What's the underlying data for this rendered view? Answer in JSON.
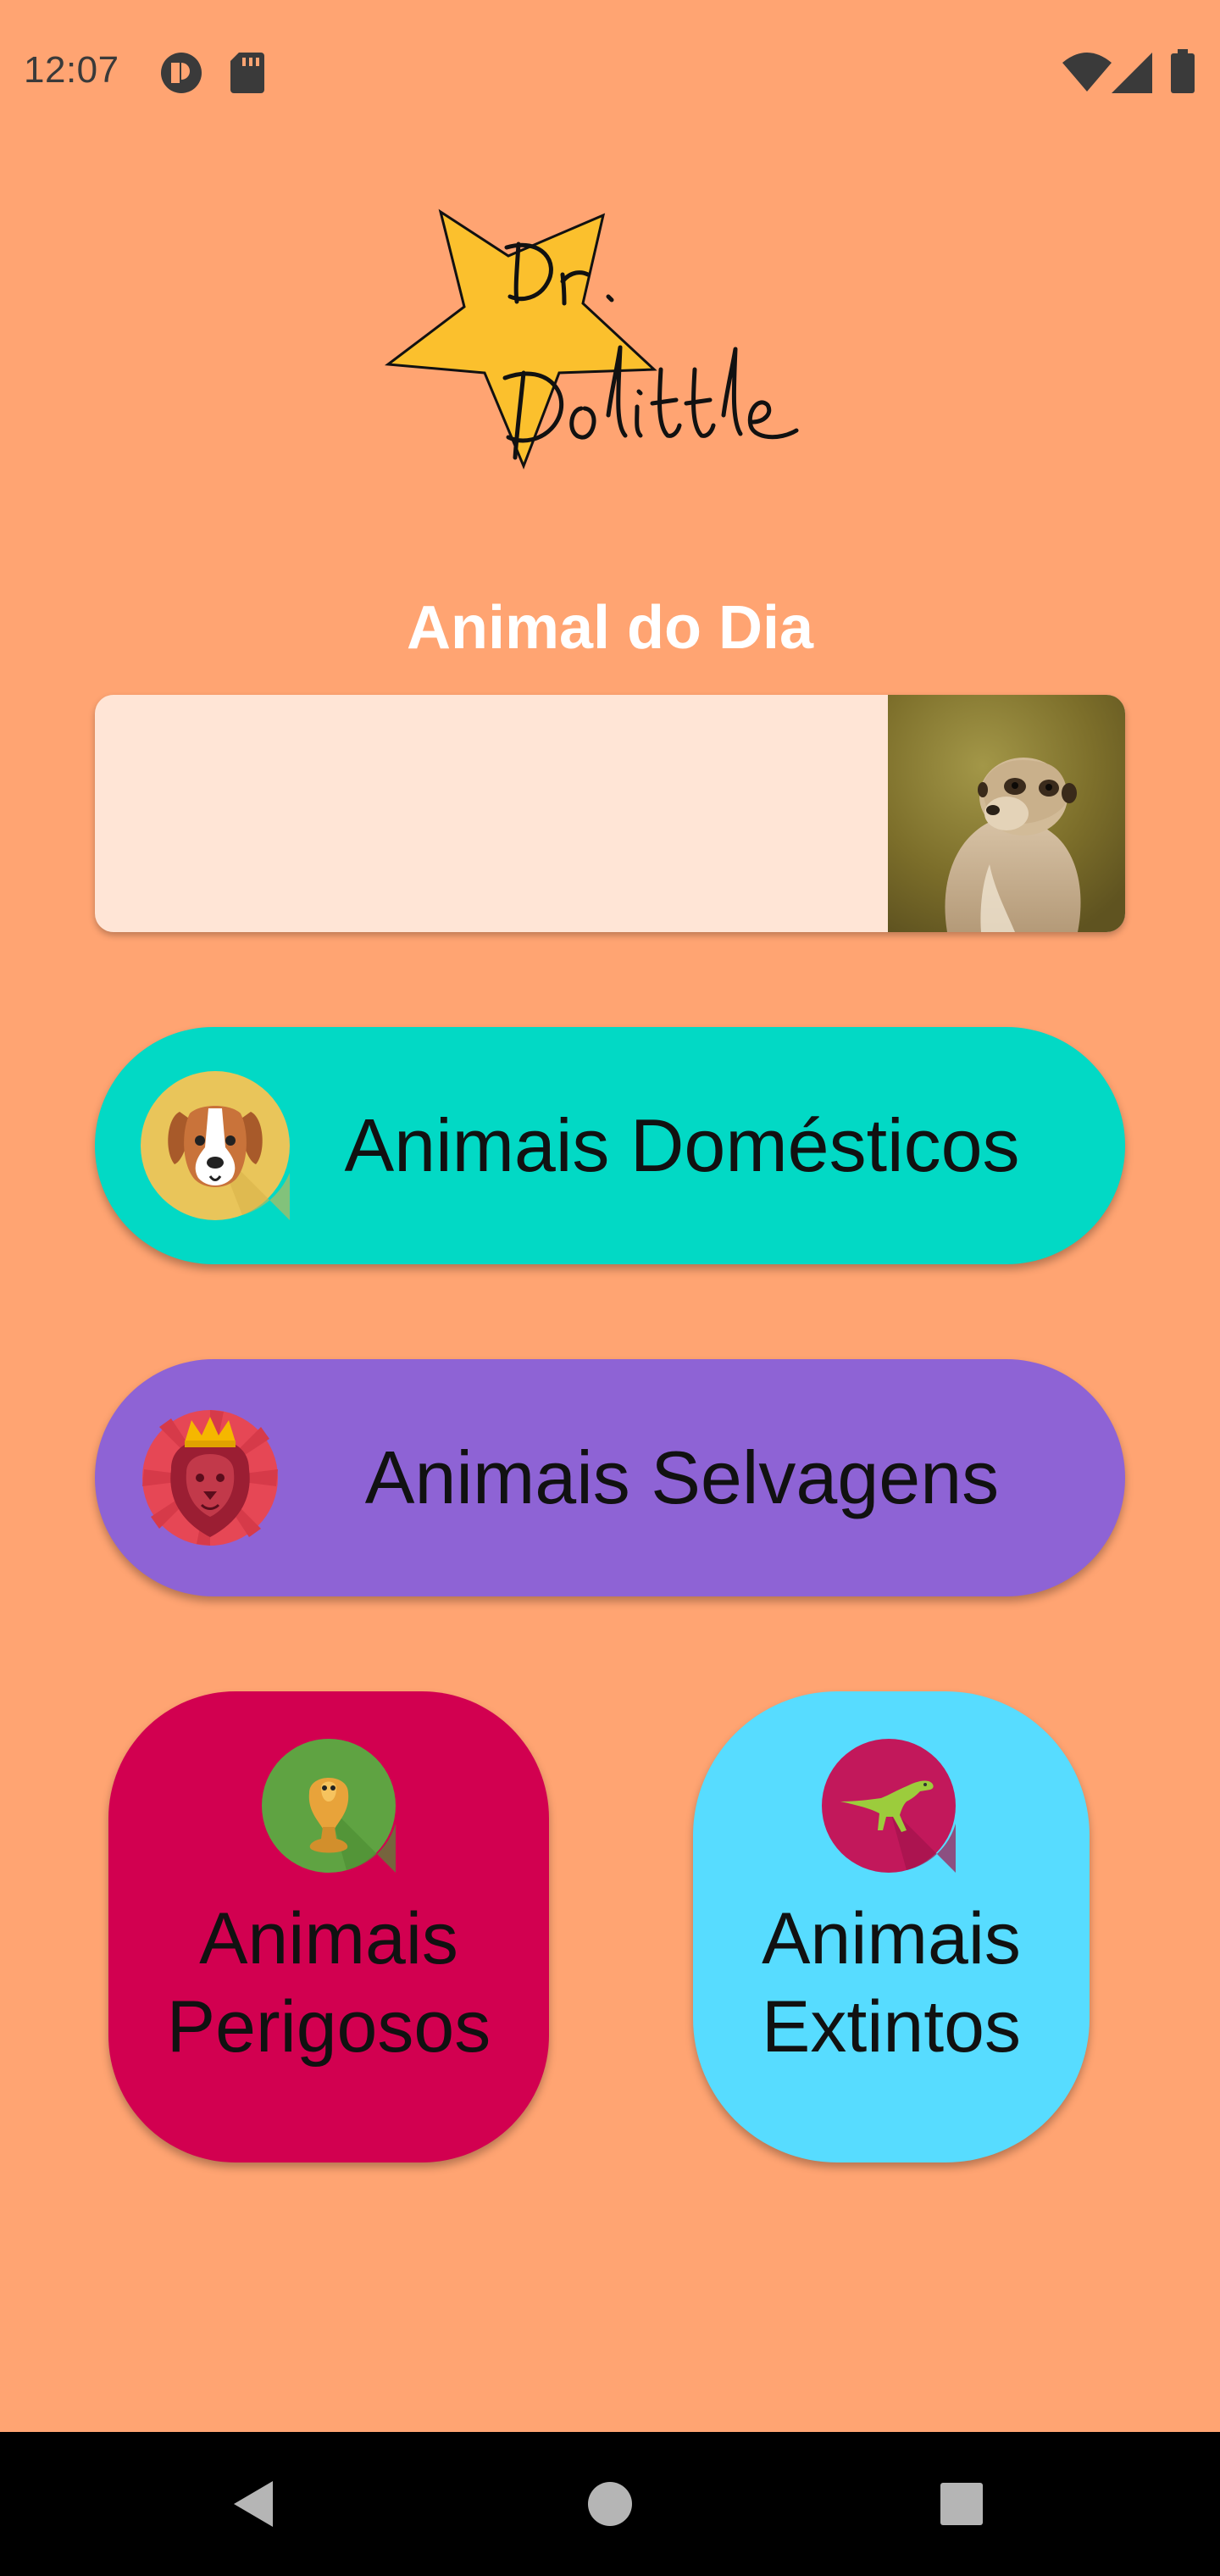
{
  "status_bar": {
    "time": "12:07",
    "left_icons": [
      "app-notification-icon",
      "sd-card-icon"
    ],
    "right_icons": [
      "wifi-icon",
      "cellular-signal-icon",
      "battery-icon"
    ]
  },
  "logo": {
    "text_line1": "Dr.",
    "text_line2": "Dolittle",
    "star_color": "#FBC02D"
  },
  "daily": {
    "title": "Animal do Dia",
    "photo": "meerkat-photo"
  },
  "buttons": {
    "domestic": {
      "label": "Animais Domésticos",
      "icon": "dog-icon",
      "color": "#02D9C5"
    },
    "wild": {
      "label": "Animais Selvagens",
      "icon": "lion-icon",
      "color": "#8E63D5"
    },
    "dangerous": {
      "line1": "Animais",
      "line2": "Perigosos",
      "icon": "snake-icon",
      "color": "#D20050"
    },
    "extinct": {
      "line1": "Animais",
      "line2": "Extintos",
      "icon": "dinosaur-icon",
      "color": "#57DCFF"
    }
  },
  "nav": {
    "items": [
      "back-icon",
      "home-icon",
      "recents-icon"
    ]
  },
  "colors": {
    "background": "#FFA472",
    "card": "#FFE5D6"
  }
}
